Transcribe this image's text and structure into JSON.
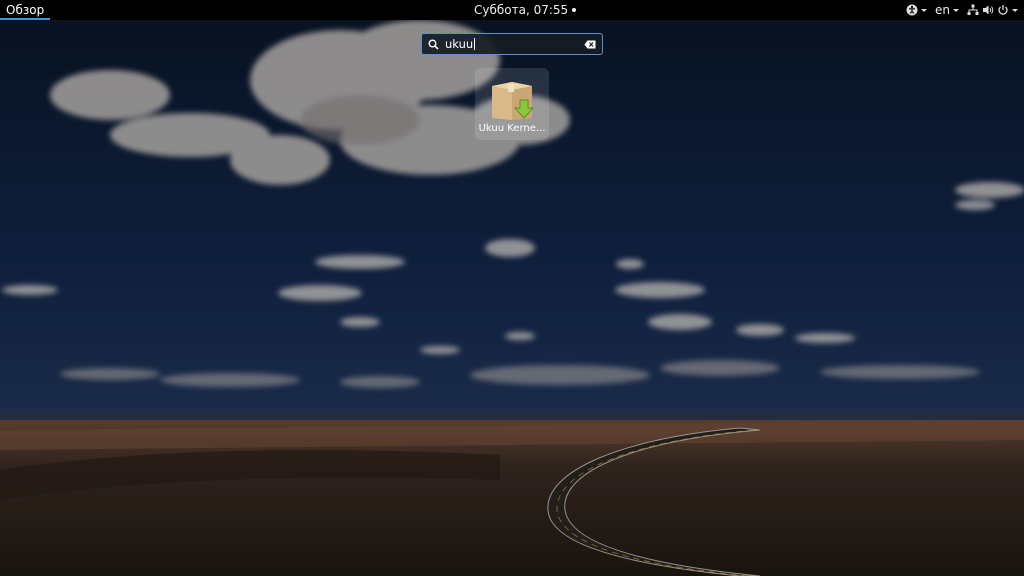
{
  "topbar": {
    "activities_label": "Обзор",
    "clock_label": "Суббота, 07:55",
    "keyboard_layout": "en",
    "tray_icons": [
      "accessibility-icon",
      "network-icon",
      "volume-icon",
      "power-icon"
    ]
  },
  "search": {
    "value": "ukuu"
  },
  "results": [
    {
      "name": "Ukuu Kerne...",
      "icon": "package-download-icon"
    }
  ],
  "colors": {
    "topbar_bg": "#000000",
    "search_border": "#5b8fd0",
    "sky_dark": "#0c1a2e",
    "desert": "#5a4636"
  }
}
